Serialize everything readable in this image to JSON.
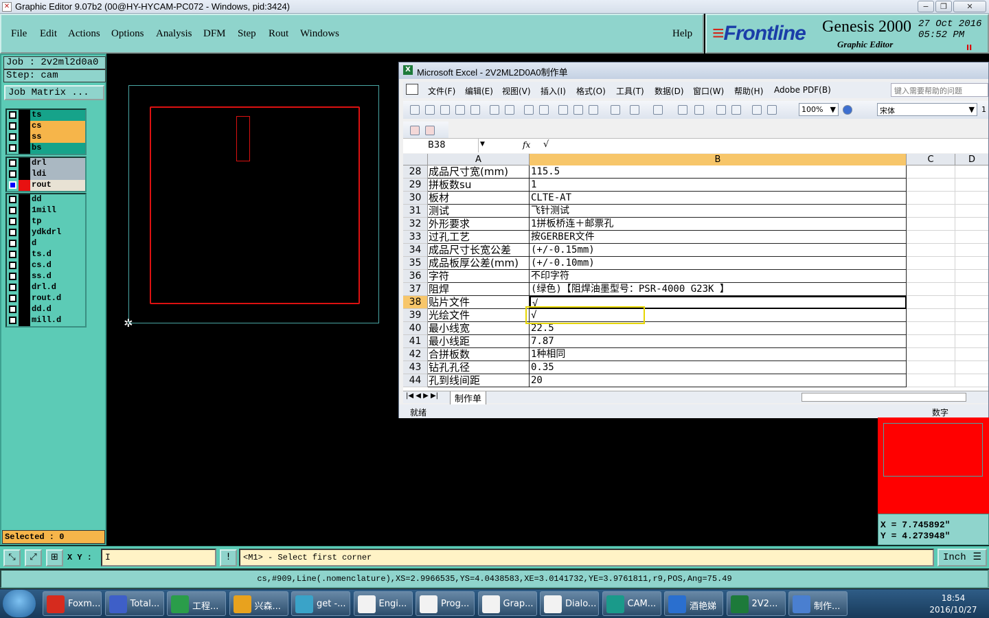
{
  "window": {
    "title": "Graphic Editor 9.07b2 (00@HY-HYCAM-PC072 - Windows, pid:3424)",
    "minimize": "−",
    "maximize": "❐",
    "close": "✕"
  },
  "menu": {
    "items": [
      "File",
      "Edit",
      "Actions",
      "Options",
      "Analysis",
      "DFM",
      "Step",
      "Rout",
      "Windows"
    ],
    "help": "Help"
  },
  "brand": {
    "logo_prefix": "≡",
    "logo": "Frontline",
    "product": "Genesis 2000",
    "subtitle": "Graphic Editor",
    "date": "27 Oct 2016",
    "time": "05:52  PM",
    "pause": "II"
  },
  "job": {
    "job_line": "Job : 2v2ml2d0a0",
    "step_line": "Step: cam",
    "matrix_button": "Job Matrix ..."
  },
  "layers": {
    "group1": [
      {
        "name": "ts",
        "color": "#16a38a"
      },
      {
        "name": "cs",
        "color": "#f6b54a"
      },
      {
        "name": "ss",
        "color": "#f6b54a"
      },
      {
        "name": "bs",
        "color": "#16a38a"
      }
    ],
    "group2": [
      {
        "name": "drl",
        "color": "#aab8c2"
      },
      {
        "name": "ldi",
        "color": "#aab8c2"
      },
      {
        "name": "rout",
        "color": "#e8e2d4"
      }
    ],
    "group3": [
      {
        "name": "dd",
        "color": "#5ccbb6"
      },
      {
        "name": "1mill",
        "color": "#5ccbb6"
      },
      {
        "name": "tp",
        "color": "#5ccbb6"
      },
      {
        "name": "ydkdrl",
        "color": "#5ccbb6"
      },
      {
        "name": "d",
        "color": "#5ccbb6"
      },
      {
        "name": "ts.d",
        "color": "#5ccbb6"
      },
      {
        "name": "cs.d",
        "color": "#5ccbb6"
      },
      {
        "name": "ss.d",
        "color": "#5ccbb6"
      },
      {
        "name": "drl.d",
        "color": "#5ccbb6"
      },
      {
        "name": "rout.d",
        "color": "#5ccbb6"
      },
      {
        "name": "dd.d",
        "color": "#5ccbb6"
      },
      {
        "name": "mill.d",
        "color": "#5ccbb6"
      }
    ]
  },
  "selected": "Selected : 0",
  "command": {
    "xy_label": "X Y :",
    "xy_value": "I",
    "warn": "!",
    "message": "<M1> - Select first corner",
    "units": "Inch",
    "units_arrow": "☰"
  },
  "status_line": "cs,#909,Line(.nomenclature),XS=2.9966535,YS=4.0438583,XE=3.0141732,YE=3.9761811,r9,POS,Ang=75.49",
  "coords": {
    "x": "X  =  7.745892\"",
    "y": "Y  =  4.273948\""
  },
  "excel": {
    "title": "Microsoft Excel - 2V2ML2D0A0制作单",
    "menu": [
      "文件(F)",
      "编辑(E)",
      "视图(V)",
      "插入(I)",
      "格式(O)",
      "工具(T)",
      "数据(D)",
      "窗口(W)",
      "帮助(H)",
      "Adobe PDF(B)"
    ],
    "help_placeholder": "键入需要帮助的问题",
    "zoom": "100%",
    "font": "宋体",
    "font_size": "1",
    "namebox": "B38",
    "fx": "fx",
    "formula": "√",
    "columns": [
      "A",
      "B",
      "C",
      "D"
    ],
    "rows": [
      {
        "n": "28",
        "a": "成品尺寸宽(mm)",
        "b": "115.5"
      },
      {
        "n": "29",
        "a": "拼板数su",
        "b": "1"
      },
      {
        "n": "30",
        "a": "板材",
        "b": "CLTE-AT"
      },
      {
        "n": "31",
        "a": "测试",
        "b": "飞针测试"
      },
      {
        "n": "32",
        "a": "外形要求",
        "b": "1拼板桥连＋邮票孔"
      },
      {
        "n": "33",
        "a": "过孔工艺",
        "b": "按GERBER文件"
      },
      {
        "n": "34",
        "a": "成品尺寸长宽公差",
        "b": "(+/-0.15mm)"
      },
      {
        "n": "35",
        "a": "成品板厚公差(mm)",
        "b": "(+/-0.10mm)"
      },
      {
        "n": "36",
        "a": "字符",
        "b": "不印字符"
      },
      {
        "n": "37",
        "a": "阻焊",
        "b": "(绿色)【阻焊油墨型号：PSR-4000 G23K 】"
      },
      {
        "n": "38",
        "a": "贴片文件",
        "b": "√"
      },
      {
        "n": "39",
        "a": "光绘文件",
        "b": "√"
      },
      {
        "n": "40",
        "a": "最小线宽",
        "b": "22.5"
      },
      {
        "n": "41",
        "a": "最小线距",
        "b": "7.87"
      },
      {
        "n": "42",
        "a": "合拼板数",
        "b": "1种相同"
      },
      {
        "n": "43",
        "a": "钻孔孔径",
        "b": "0.35"
      },
      {
        "n": "44",
        "a": "孔到线间距",
        "b": "20"
      }
    ],
    "sheet_tab": "制作单",
    "status_ready": "就绪",
    "status_num": "数字"
  },
  "taskbar": {
    "items": [
      {
        "label": "Foxm...",
        "color": "#d62b1e"
      },
      {
        "label": "Total...",
        "color": "#3e5fc8"
      },
      {
        "label": "工程...",
        "color": "#2a9d4a"
      },
      {
        "label": "兴森...",
        "color": "#e8a21e"
      },
      {
        "label": "get -...",
        "color": "#3aa3c8"
      },
      {
        "label": "Engi...",
        "color": "#f2f2f2"
      },
      {
        "label": "Prog...",
        "color": "#f2f2f2"
      },
      {
        "label": "Grap...",
        "color": "#f2f2f2"
      },
      {
        "label": "Dialo...",
        "color": "#f2f2f2"
      },
      {
        "label": "CAM...",
        "color": "#1a9a8a"
      },
      {
        "label": "酒艳娣",
        "color": "#2a6fcf"
      },
      {
        "label": "2V2...",
        "color": "#1d7a3a"
      },
      {
        "label": "制作...",
        "color": "#4a7fd0"
      }
    ],
    "time": "18:54",
    "date": "2016/10/27"
  }
}
